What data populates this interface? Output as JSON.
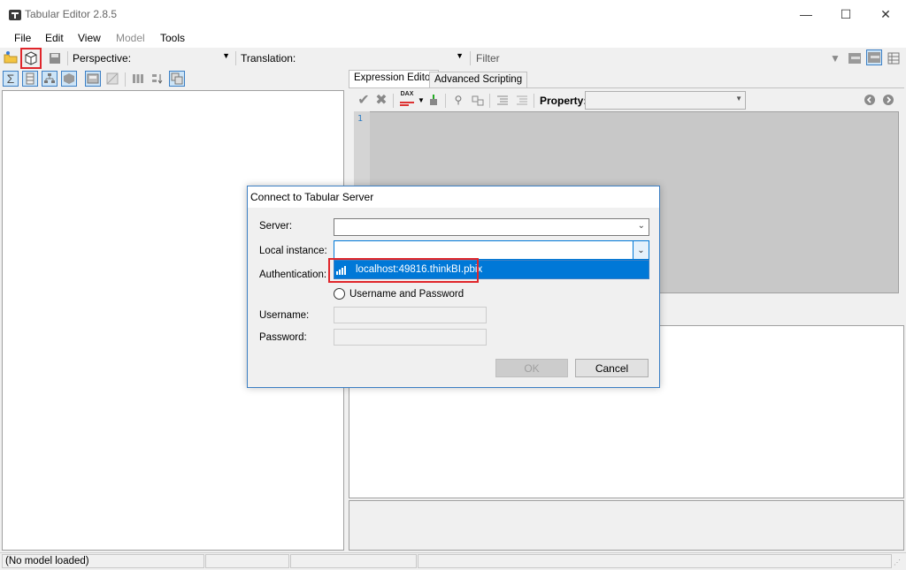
{
  "window": {
    "title": "Tabular Editor 2.8.5",
    "minimize": "—",
    "maximize": "☐",
    "close": "✕"
  },
  "menu": {
    "file": "File",
    "edit": "Edit",
    "view": "View",
    "model": "Model",
    "tools": "Tools"
  },
  "toolbar": {
    "perspective_label": "Perspective:",
    "translation_label": "Translation:",
    "filter_placeholder": "Filter",
    "icons": [
      "open-icon",
      "connect-icon",
      "save-icon",
      "filter-icon",
      "layout-icon",
      "layout-icon-2",
      "grid-icon"
    ]
  },
  "tabs": {
    "expression_editor": "Expression Editor",
    "advanced_scripting": "Advanced Scripting"
  },
  "editor": {
    "property_label": "Property:",
    "line_number": "1",
    "dax_label": "DAX"
  },
  "statusbar": {
    "status": "(No model loaded)"
  },
  "dialog": {
    "title": "Connect to Tabular Server",
    "server_label": "Server:",
    "local_instance_label": "Local instance:",
    "authentication_label": "Authentication:",
    "username_password_option": "Username and Password",
    "username_label": "Username:",
    "password_label": "Password:",
    "dropdown_option": "localhost:49816.thinkBI.pbix",
    "ok": "OK",
    "cancel": "Cancel"
  },
  "colors": {
    "accent": "#0078d7",
    "highlight_box": "#e0262b"
  }
}
